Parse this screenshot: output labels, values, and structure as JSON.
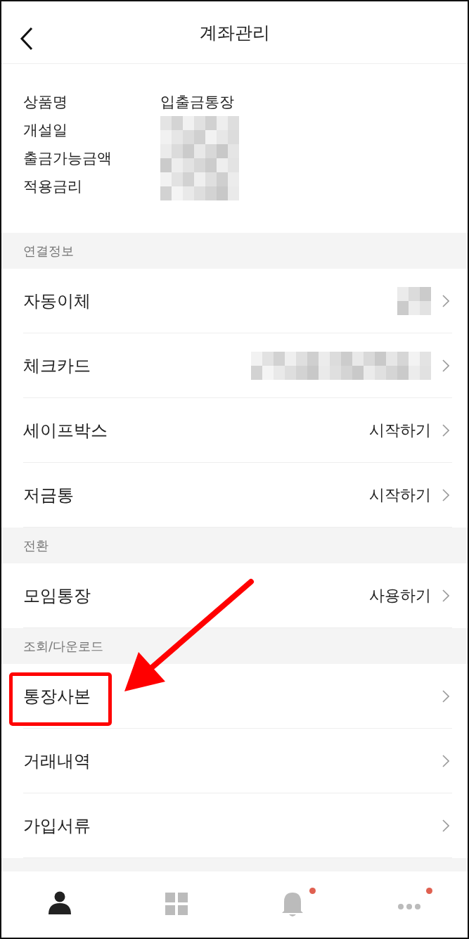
{
  "header": {
    "title": "계좌관리"
  },
  "info": [
    {
      "label": "상품명",
      "value": "입출금통장",
      "redacted": false
    },
    {
      "label": "개설일",
      "redacted": true
    },
    {
      "label": "출금가능금액",
      "redacted": true
    },
    {
      "label": "적용금리",
      "redacted": true
    }
  ],
  "sections": [
    {
      "title": "연결정보",
      "rows": [
        {
          "label": "자동이체",
          "redacted": true,
          "highlighted": false
        },
        {
          "label": "체크카드",
          "redacted": true,
          "highlighted": false
        },
        {
          "label": "세이프박스",
          "value": "시작하기",
          "redacted": false,
          "highlighted": false
        },
        {
          "label": "저금통",
          "value": "시작하기",
          "redacted": false,
          "highlighted": false
        }
      ]
    },
    {
      "title": "전환",
      "rows": [
        {
          "label": "모임통장",
          "value": "사용하기",
          "redacted": false,
          "highlighted": false
        }
      ]
    },
    {
      "title": "조회/다운로드",
      "rows": [
        {
          "label": "통장사본",
          "redacted": false,
          "highlighted": true
        },
        {
          "label": "거래내역",
          "redacted": false,
          "highlighted": false
        },
        {
          "label": "가입서류",
          "redacted": false,
          "highlighted": false
        }
      ]
    }
  ],
  "bottom_nav": [
    {
      "kind": "person",
      "selected": true,
      "badge": false
    },
    {
      "kind": "grid",
      "selected": false,
      "badge": false
    },
    {
      "kind": "bell",
      "selected": false,
      "badge": true
    },
    {
      "kind": "more",
      "selected": false,
      "badge": true
    }
  ]
}
